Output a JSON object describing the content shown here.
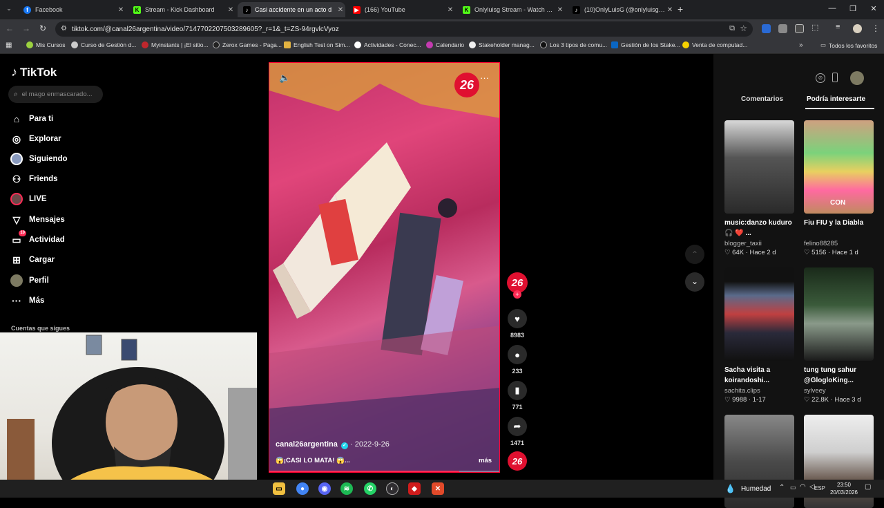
{
  "browser": {
    "tabs": [
      {
        "label": "Facebook",
        "icon": "facebook-icon",
        "color": "#1877f2",
        "glyph": "f"
      },
      {
        "label": "Stream - Kick Dashboard",
        "icon": "kick-icon",
        "color": "#53fc18",
        "glyph": "K"
      },
      {
        "label": "Casi accidente en un acto d",
        "icon": "tiktok-icon",
        "color": "#000000",
        "glyph": "♪"
      },
      {
        "label": "(166) YouTube",
        "icon": "youtube-icon",
        "color": "#ff0000",
        "glyph": "▶"
      },
      {
        "label": "Onlyluisg Stream - Watch Live",
        "icon": "kick-icon",
        "color": "#53fc18",
        "glyph": "K"
      },
      {
        "label": "(10)OnlyLuisG (@onlyluisg1) |",
        "icon": "tiktok-icon",
        "color": "#000000",
        "glyph": "♪"
      }
    ],
    "url": "tiktok.com/@canal26argentina/video/7147702207503289605?_r=1&_t=ZS-94rgvlcVyoz",
    "bookmarks": [
      {
        "label": "Mis Cursos",
        "color": "#9bd13f"
      },
      {
        "label": "Curso de Gestión d...",
        "color": "#cccccc"
      },
      {
        "label": "Myinstants | ¡El sitio...",
        "color": "#c0272d"
      },
      {
        "label": "Zerox Games - Paga...",
        "color": "#222222"
      },
      {
        "label": "English Test on Sim...",
        "color": "#e3b341"
      },
      {
        "label": "Actividades - Conec...",
        "color": "#ffffff"
      },
      {
        "label": "Calendario",
        "color": "#c43bb0"
      },
      {
        "label": "Stakeholder manag...",
        "color": "#f0f0f0"
      },
      {
        "label": "Los 3 tipos de comu...",
        "color": "#111111"
      },
      {
        "label": "Gestión de los Stake...",
        "color": "#0a66c2"
      },
      {
        "label": "Venta de computad...",
        "color": "#f5d100"
      }
    ],
    "all_favorites": "Todos los favoritos"
  },
  "sidebar": {
    "logo": "TikTok",
    "search_placeholder": "el mago enmascarado...",
    "items": [
      {
        "label": "Para ti",
        "icon": "home-icon"
      },
      {
        "label": "Explorar",
        "icon": "compass-icon"
      },
      {
        "label": "Siguiendo",
        "icon": "following-icon"
      },
      {
        "label": "Friends",
        "icon": "friends-icon"
      },
      {
        "label": "LIVE",
        "icon": "live-icon"
      },
      {
        "label": "Mensajes",
        "icon": "message-icon"
      },
      {
        "label": "Actividad",
        "icon": "activity-icon",
        "badge": "10"
      },
      {
        "label": "Cargar",
        "icon": "upload-icon"
      },
      {
        "label": "Perfil",
        "icon": "profile-icon"
      },
      {
        "label": "Más",
        "icon": "more-icon"
      }
    ],
    "following_heading": "Cuentas que sigues"
  },
  "video": {
    "author": "canal26argentina",
    "date": "· 2022-9-26",
    "caption": "😱¡CASI LO MATA! 😱...",
    "more": "más",
    "brand_badge": "26"
  },
  "actions": [
    {
      "icon": "heart-icon",
      "count": "8983"
    },
    {
      "icon": "comment-icon",
      "count": "233"
    },
    {
      "icon": "bookmark-icon",
      "count": "771"
    },
    {
      "icon": "share-icon",
      "count": "1471"
    }
  ],
  "right_panel": {
    "tabs": [
      "Comentarios",
      "Podría interesarte"
    ],
    "cards": [
      {
        "title": "music:danzo kuduro🎧 ❤️ ...",
        "author": "blogger_taxii",
        "likes": "64K",
        "time": "Hace 2 d"
      },
      {
        "title": "Fiu FIU y la Diabla",
        "author": "felino88285",
        "likes": "5156",
        "time": "Hace 1 d"
      },
      {
        "title": "Sacha visita a koirandoshi...",
        "author": "sachita.clips",
        "likes": "9988",
        "time": "1-17"
      },
      {
        "title": "tung tung sahur @GlogloKing...",
        "author": "sylveey",
        "likes": "22.8K",
        "time": "Hace 3 d"
      }
    ],
    "thumb_text_1": "CON"
  },
  "taskbar": {
    "weather": "Humedad",
    "lang": "ESP",
    "time": "23:50",
    "date": "20/03/2026"
  }
}
